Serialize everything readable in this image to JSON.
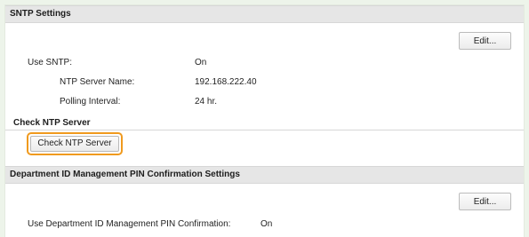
{
  "sntp": {
    "title": "SNTP Settings",
    "edit_label": "Edit...",
    "use_sntp_label": "Use SNTP:",
    "use_sntp_value": "On",
    "server_name_label": "NTP Server Name:",
    "server_name_value": "192.168.222.40",
    "polling_label": "Polling Interval:",
    "polling_value": "24 hr."
  },
  "check_ntp": {
    "heading": "Check NTP Server",
    "button_label": "Check NTP Server"
  },
  "department": {
    "title": "Department ID Management PIN Confirmation Settings",
    "edit_label": "Edit...",
    "pin_label": "Use Department ID Management PIN Confirmation:",
    "pin_value": "On"
  },
  "colors": {
    "highlight": "#f09a1e",
    "header_background": "#e6e6e6",
    "outer_background": "#edf4ea"
  }
}
